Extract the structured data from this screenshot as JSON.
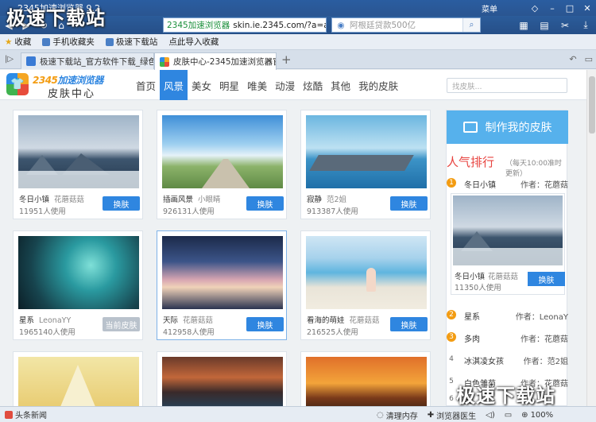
{
  "window": {
    "title": "2345加速浏览器 9.2",
    "menu": "菜单"
  },
  "toolbar": {
    "address": "skin.ie.2345.com/?a=all&t=",
    "address_prefix": "2345加速浏览器",
    "search_placeholder": "阿根廷贷款500亿"
  },
  "favbar": {
    "items": [
      "收藏",
      "手机收藏夹",
      "极速下载站",
      "点此导入收藏"
    ]
  },
  "tabs": [
    {
      "label": "极速下载站_官方软件下载_绿色"
    },
    {
      "label": "皮肤中心-2345加速浏览器官网"
    }
  ],
  "header": {
    "logo_top_a": "2345",
    "logo_top_b": "加速浏览器",
    "logo_sub": "皮肤中心",
    "search_placeholder": "找皮肤..."
  },
  "nav": [
    "首页",
    "风景",
    "美女",
    "明星",
    "唯美",
    "动漫",
    "炫酷",
    "其他",
    "我的皮肤"
  ],
  "cards": [
    {
      "name": "冬日小镇",
      "author": "花蘑菇菇",
      "uses": "11951人使用",
      "button": "换肤"
    },
    {
      "name": "插画风景",
      "author": "小眼睛",
      "uses": "926131人使用",
      "button": "换肤"
    },
    {
      "name": "寂静",
      "author": "范2姐",
      "uses": "913387人使用",
      "button": "换肤"
    },
    {
      "name": "星系",
      "author": "LeonaYY",
      "uses": "1965140人使用",
      "button": "当前皮肤"
    },
    {
      "name": "天际",
      "author": "花蘑菇菇",
      "uses": "412958人使用",
      "button": "换肤"
    },
    {
      "name": "看海的萌娃",
      "author": "花蘑菇菇",
      "uses": "216525人使用",
      "button": "换肤"
    }
  ],
  "sidebar": {
    "make_label": "制作我的皮肤",
    "rank_title": "人气排行",
    "rank_note": "（每天10:00准时更新）",
    "author_prefix": "作者：",
    "top": {
      "rank": "1",
      "name": "冬日小镇",
      "author": "花蘑菇",
      "card_name": "冬日小镇",
      "card_author": "花蘑菇菇",
      "uses": "11350人使用",
      "button": "换肤"
    },
    "list": [
      {
        "rank": "2",
        "name": "星系",
        "author": "LeonaY"
      },
      {
        "rank": "3",
        "name": "多肉",
        "author": "花蘑菇"
      },
      {
        "rank": "4",
        "name": "冰淇凌女孩",
        "author": "范2姐"
      },
      {
        "rank": "5",
        "name": "白色雏菊",
        "author": "花蘑菇"
      },
      {
        "rank": "6",
        "name": "大",
        "author": ""
      }
    ]
  },
  "status": {
    "news": "头条新闻",
    "items": [
      "清理内存",
      "浏览器医生",
      "100%"
    ]
  },
  "watermark": "极速下载站",
  "colors": {
    "accent": "#2f86e0",
    "rank_red": "#e8433f",
    "rank_orange": "#f39c12"
  }
}
